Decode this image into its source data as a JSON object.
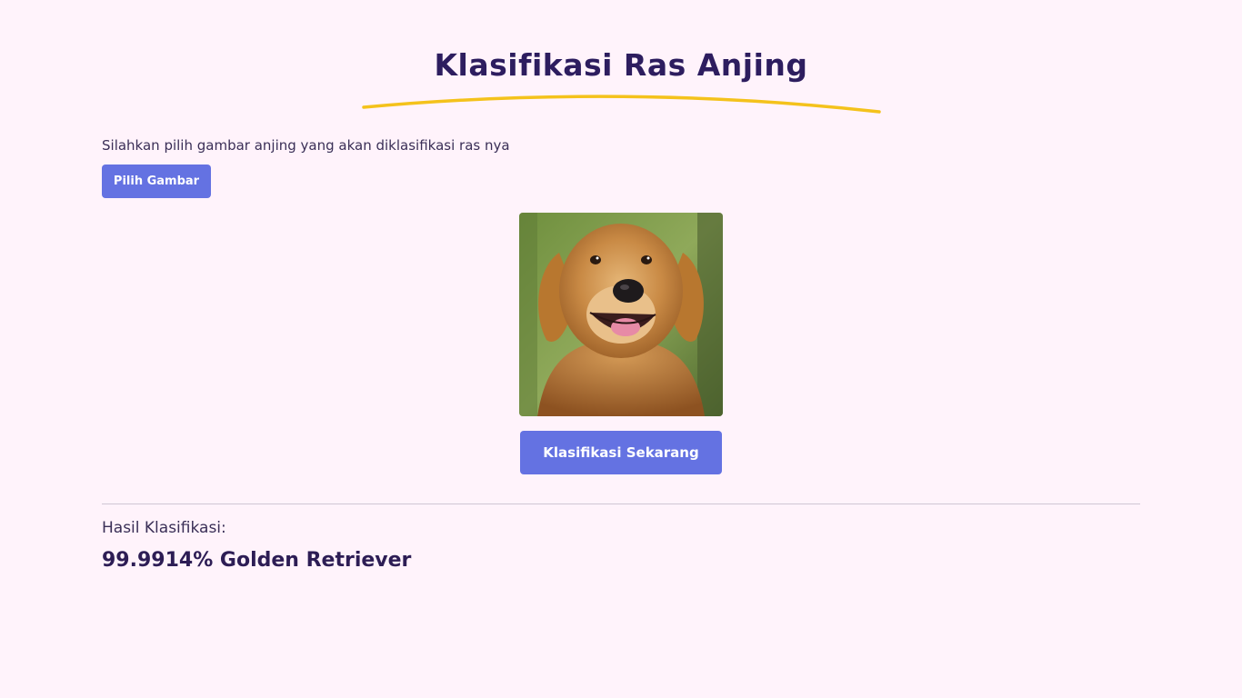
{
  "header": {
    "title": "Klasifikasi Ras Anjing"
  },
  "upload": {
    "instruction": "Silahkan pilih gambar anjing yang akan diklasifikasi ras nya",
    "pick_button_label": "Pilih Gambar"
  },
  "preview": {
    "subject": "golden retriever photo"
  },
  "actions": {
    "classify_button_label": "Klasifikasi Sekarang"
  },
  "result": {
    "label": "Hasil Klasifikasi:",
    "value": "99.9914% Golden Retriever"
  },
  "colors": {
    "background": "#fff3fb",
    "title": "#2d1d5f",
    "accent_button": "#6472e2",
    "underline": "#f4c21b"
  }
}
